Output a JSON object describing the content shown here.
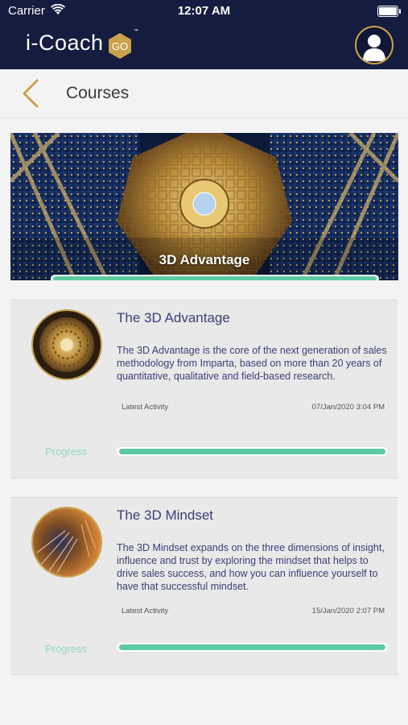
{
  "status_bar": {
    "carrier": "Carrier",
    "time": "12:07 AM"
  },
  "header": {
    "logo_text": "i-Coach",
    "logo_badge": "GO",
    "logo_tm": "™"
  },
  "nav": {
    "title": "Courses"
  },
  "banner": {
    "title": "3D Advantage",
    "progress": 1.0
  },
  "courses": [
    {
      "title": "The 3D Advantage",
      "description": "The 3D Advantage is the core of the next generation of sales methodology from Imparta, based on more than 20 years of quantitative, qualitative and field-based research.",
      "activity_label": "Latest Activity",
      "activity_date": "07/Jan/2020 3:04 PM",
      "progress_label": "Progress",
      "progress": 1.0
    },
    {
      "title": "The 3D Mindset",
      "description": "The 3D Mindset expands on the three dimensions of insight, influence and trust by exploring the mindset that helps to drive sales success, and how you can influence yourself to have that successful mindset.",
      "activity_label": "Latest Activity",
      "activity_date": "15/Jan/2020 2:07 PM",
      "progress_label": "Progress",
      "progress": 1.0
    }
  ],
  "colors": {
    "header_bg": "#141c3f",
    "accent_gold": "#c9a24b",
    "progress_green": "#5ccaa2",
    "text_navy": "#3b3f77"
  },
  "icons": [
    "wifi-icon",
    "battery-icon",
    "user-avatar-icon",
    "back-chevron-icon"
  ]
}
